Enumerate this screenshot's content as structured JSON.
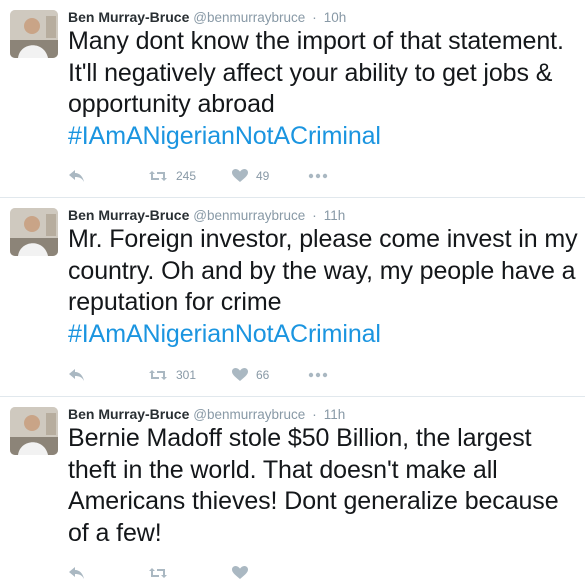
{
  "colors": {
    "accent": "#1b95e0",
    "muted": "#8899a6",
    "border": "#e1e8ed"
  },
  "tweets": [
    {
      "name": "Ben Murray-Bruce",
      "handle": "@benmurraybruce",
      "separator": "·",
      "time": "10h",
      "text": "Many dont know the import of that statement. It'll negatively affect your ability to get jobs & opportunity abroad",
      "hashtag": "#IAmANigerianNotACriminal",
      "retweets": "245",
      "likes": "49",
      "icons": [
        "reply-icon",
        "retweet-icon",
        "heart-icon",
        "more-icon"
      ]
    },
    {
      "name": "Ben Murray-Bruce",
      "handle": "@benmurraybruce",
      "separator": "·",
      "time": "11h",
      "text": "Mr. Foreign investor, please come invest in my country. Oh and by the way, my people have a reputation for crime",
      "hashtag": "#IAmANigerianNotACriminal",
      "retweets": "301",
      "likes": "66",
      "icons": [
        "reply-icon",
        "retweet-icon",
        "heart-icon",
        "more-icon"
      ]
    },
    {
      "name": "Ben Murray-Bruce",
      "handle": "@benmurraybruce",
      "separator": "·",
      "time": "11h",
      "text": "Bernie Madoff stole $50 Billion, the largest theft in the world. That doesn't make all Americans thieves! Dont generalize because of a few!",
      "hashtag": "",
      "retweets": "",
      "likes": "",
      "icons": [
        "reply-icon",
        "retweet-icon",
        "heart-icon",
        "more-icon"
      ]
    }
  ]
}
